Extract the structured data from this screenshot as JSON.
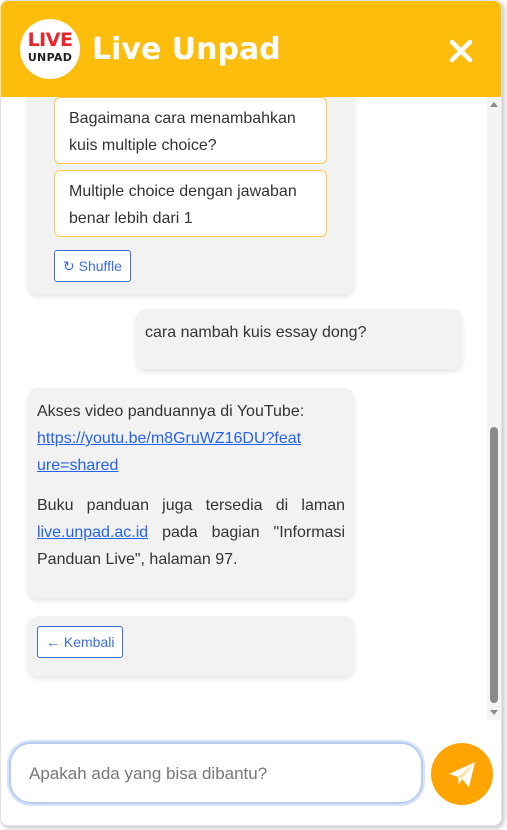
{
  "header": {
    "title": "Live Unpad",
    "logo_top": "LIVE",
    "logo_bottom": "UNPAD",
    "close_icon": "close-icon"
  },
  "conversation": {
    "suggestions": [
      "Bagaimana cara menambahkan kuis multiple choice?",
      "Multiple choice dengan jawaban benar lebih dari 1"
    ],
    "shuffle_label": "↻ Shuffle",
    "user_message": "cara nambah kuis essay dong?",
    "bot_reply": {
      "video_intro": "Akses video panduannya di YouTube:",
      "video_link": "https://youtu.be/m8GruWZ16DU?feature=shared",
      "guide_before": "Buku panduan juga tersedia di laman",
      "guide_link": "live.unpad.ac.id",
      "guide_after": "pada bagian \"Informasi Panduan Live\", halaman 97."
    },
    "back_label": "← Kembali"
  },
  "composer": {
    "placeholder": "Apakah ada yang bisa dibantu?",
    "value": "",
    "send_icon": "send-icon"
  },
  "colors": {
    "header_bg": "#fcbd0c",
    "send_bg": "#ffa400",
    "suggestion_border": "#fcc94a",
    "link": "#2563eb",
    "button_blue": "#3b6fd8"
  }
}
